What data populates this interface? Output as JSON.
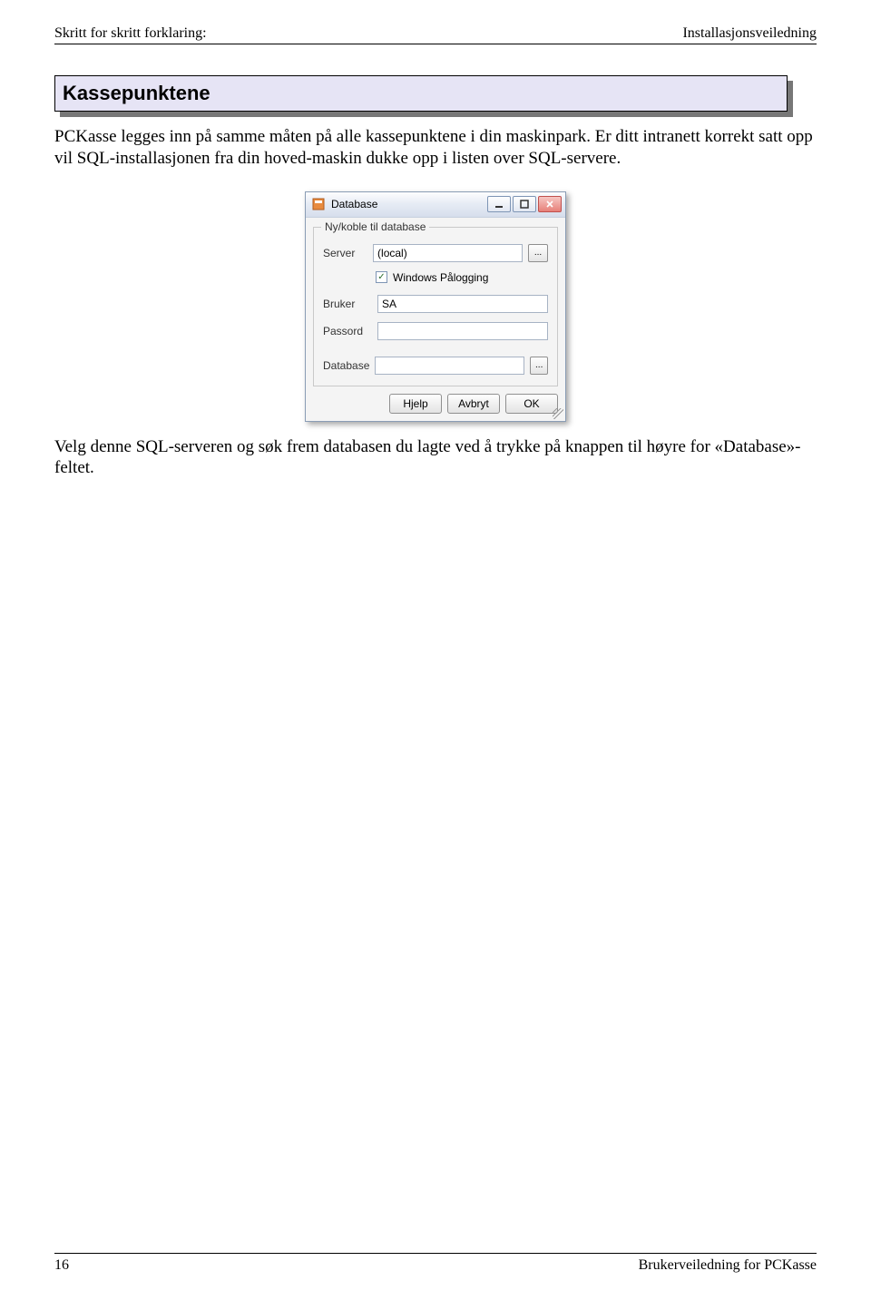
{
  "header": {
    "left": "Skritt for skritt forklaring:",
    "right": "Installasjonsveiledning"
  },
  "section": {
    "title": "Kassepunktene"
  },
  "paragraph1": "PCKasse legges inn på samme måten på alle kassepunktene i din maskinpark. Er ditt intranett korrekt satt opp vil SQL-installasjonen fra din hoved-maskin dukke opp i listen over SQL-servere.",
  "dialog": {
    "title": "Database",
    "group_legend": "Ny/koble til database",
    "server_label": "Server",
    "server_value": "(local)",
    "windows_checkbox": "Windows Pålogging",
    "bruker_label": "Bruker",
    "bruker_value": "SA",
    "passord_label": "Passord",
    "passord_value": "",
    "database_label": "Database",
    "database_value": "",
    "browse": "...",
    "buttons": {
      "hjelp": "Hjelp",
      "avbryt": "Avbryt",
      "ok": "OK"
    },
    "checkmark": "✓"
  },
  "paragraph2": "Velg denne SQL-serveren og søk frem databasen du lagte ved å trykke på knappen til høyre for «Database»-feltet.",
  "footer": {
    "page": "16",
    "right": "Brukerveiledning for PCKasse"
  }
}
